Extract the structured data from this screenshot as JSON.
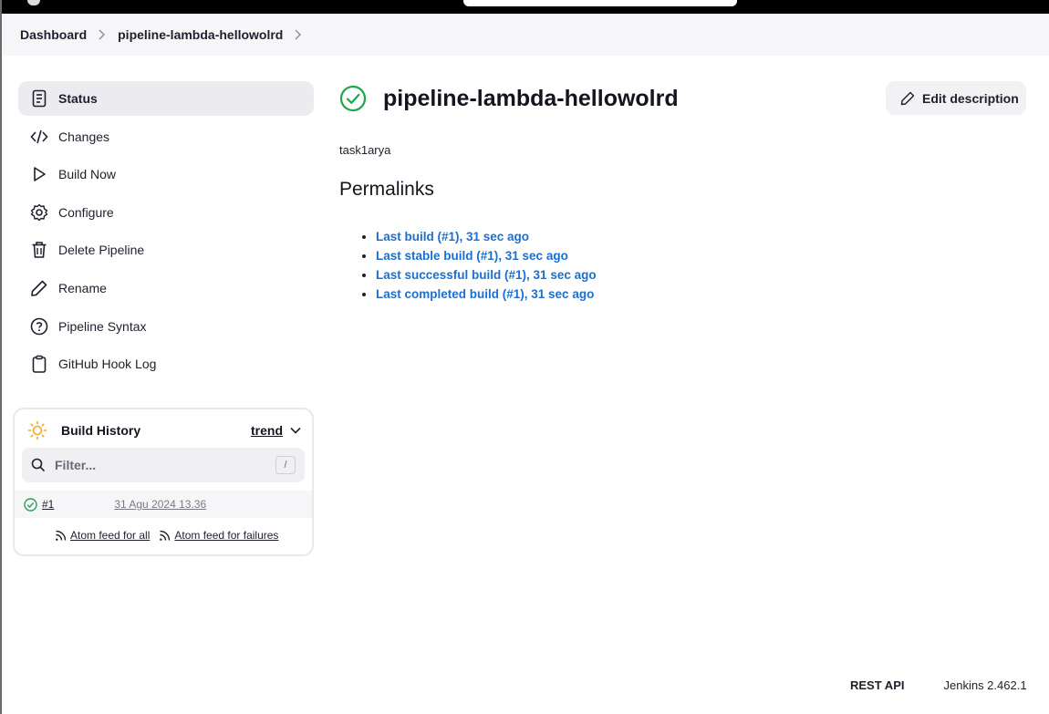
{
  "breadcrumb": {
    "items": [
      "Dashboard",
      "pipeline-lambda-hellowolrd"
    ]
  },
  "sidebar": {
    "items": [
      {
        "label": "Status",
        "icon": "document-icon",
        "active": true
      },
      {
        "label": "Changes",
        "icon": "code-icon"
      },
      {
        "label": "Build Now",
        "icon": "play-icon"
      },
      {
        "label": "Configure",
        "icon": "gear-icon"
      },
      {
        "label": "Delete Pipeline",
        "icon": "trash-icon"
      },
      {
        "label": "Rename",
        "icon": "pencil-icon"
      },
      {
        "label": "Pipeline Syntax",
        "icon": "help-icon"
      },
      {
        "label": "GitHub Hook Log",
        "icon": "clipboard-icon"
      }
    ]
  },
  "build_history": {
    "title": "Build History",
    "trend_label": "trend",
    "filter_placeholder": "Filter...",
    "filter_shortcut": "/",
    "builds": [
      {
        "number": "#1",
        "date": "31 Agu 2024 13.36",
        "status": "success"
      }
    ],
    "feed_all": "Atom feed for all",
    "feed_failures": "Atom feed for failures"
  },
  "main": {
    "title": "pipeline-lambda-hellowolrd",
    "edit_description": "Edit description",
    "description": "task1arya",
    "permalinks_title": "Permalinks",
    "permalinks": [
      "Last build (#1), 31 sec ago",
      "Last stable build (#1), 31 sec ago",
      "Last successful build (#1), 31 sec ago",
      "Last completed build (#1), 31 sec ago"
    ]
  },
  "footer": {
    "rest_api": "REST API",
    "version": "Jenkins 2.462.1"
  },
  "colors": {
    "success": "#1ea64b",
    "link": "#1b6fd1",
    "sun": "#f5a623"
  }
}
